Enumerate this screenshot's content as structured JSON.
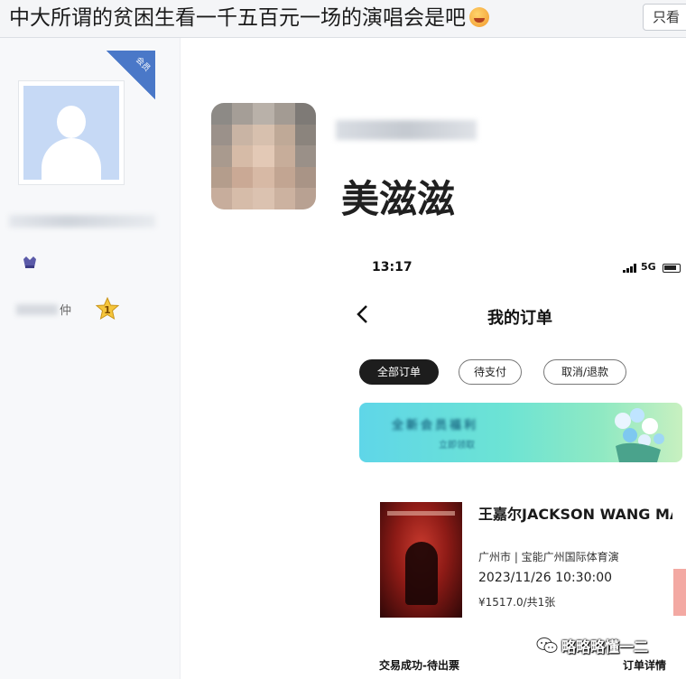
{
  "post": {
    "title": "中大所谓的贫困生看一千五百元一场的演唱会是吧",
    "only_view_label": "只看"
  },
  "profile": {
    "vip_badge": "会员",
    "level_suffix": "仲",
    "level_badge_number": "1"
  },
  "reply": {
    "username": "美滋滋"
  },
  "phone": {
    "time": "13:17",
    "network": "5G",
    "page_title": "我的订单",
    "tabs": [
      "全部订单",
      "待支付",
      "取消/退款"
    ],
    "banner_text": "全新会员福利",
    "banner_sub": "立即领取",
    "order": {
      "name": "王嘉尔JACKSON WANG MAGIC MAN ...",
      "venue": "广州市 | 宝能广州国际体育演",
      "datetime": "2023/11/26 10:30:00",
      "price": "¥1517.0/共1张",
      "status": "交易成功-待出票",
      "detail_label": "订单详情"
    }
  },
  "watermark": {
    "text": "略略略懂一二"
  }
}
